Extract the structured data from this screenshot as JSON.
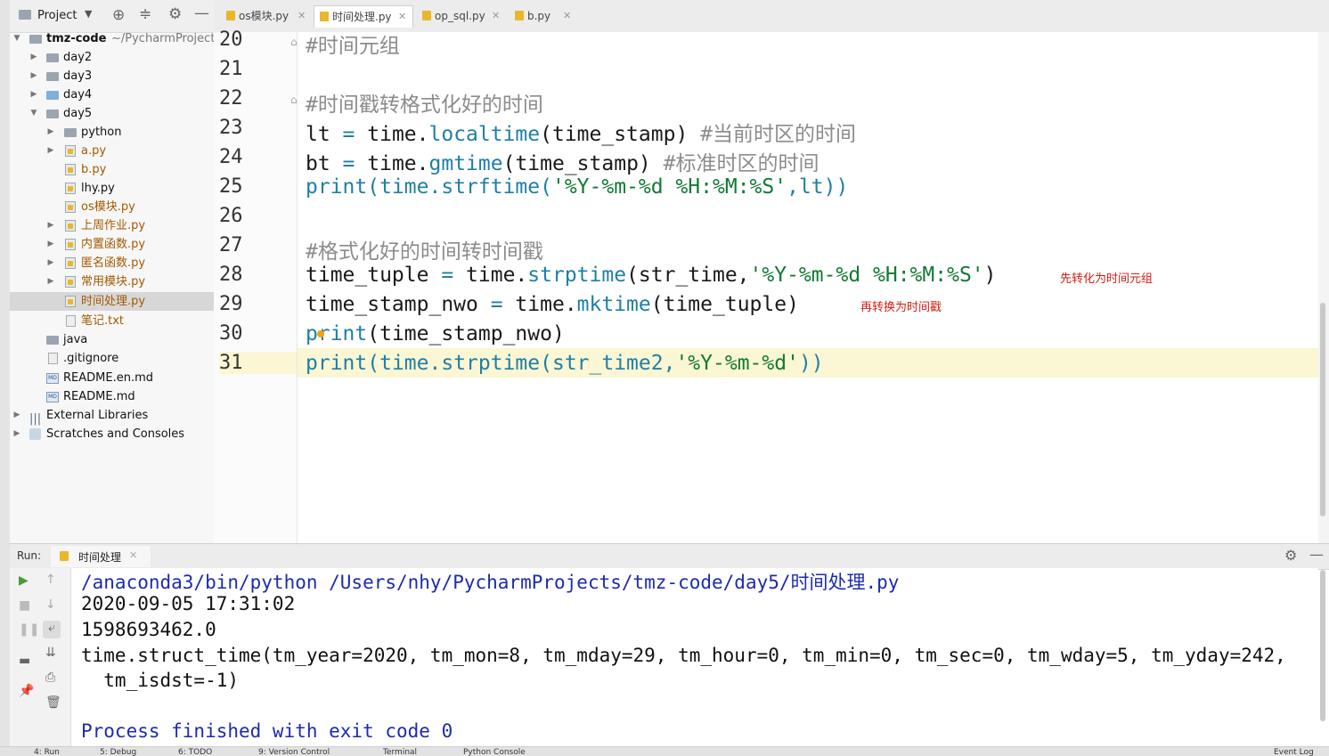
{
  "project_panel": {
    "title": "Project",
    "root": {
      "name": "tmz-code",
      "path": "~/PycharmProject"
    },
    "items": [
      {
        "label": "day2",
        "kind": "folder"
      },
      {
        "label": "day3",
        "kind": "folder"
      },
      {
        "label": "day4",
        "kind": "folder"
      },
      {
        "label": "day5",
        "kind": "folder"
      },
      {
        "label": "python",
        "kind": "folder"
      },
      {
        "label": "a.py",
        "kind": "py"
      },
      {
        "label": "b.py",
        "kind": "py"
      },
      {
        "label": "lhy.py",
        "kind": "py"
      },
      {
        "label": "os模块.py",
        "kind": "py"
      },
      {
        "label": "上周作业.py",
        "kind": "py"
      },
      {
        "label": "内置函数.py",
        "kind": "py"
      },
      {
        "label": "匿名函数.py",
        "kind": "py"
      },
      {
        "label": "常用模块.py",
        "kind": "py"
      },
      {
        "label": "时间处理.py",
        "kind": "py"
      },
      {
        "label": "笔记.txt",
        "kind": "txt"
      },
      {
        "label": "java",
        "kind": "folder"
      },
      {
        "label": ".gitignore",
        "kind": "file"
      },
      {
        "label": "README.en.md",
        "kind": "md"
      },
      {
        "label": "README.md",
        "kind": "md"
      },
      {
        "label": "External Libraries",
        "kind": "lib"
      },
      {
        "label": "Scratches and Consoles",
        "kind": "scratch"
      }
    ]
  },
  "tabs": [
    {
      "label": "os模块.py"
    },
    {
      "label": "时间处理.py",
      "active": true
    },
    {
      "label": "op_sql.py"
    },
    {
      "label": "b.py"
    }
  ],
  "editor": {
    "line_numbers": [
      "20",
      "21",
      "22",
      "23",
      "24",
      "25",
      "26",
      "27",
      "28",
      "29",
      "30",
      "31"
    ],
    "lines": {
      "l20": "#时间元组",
      "l22": "#时间戳转格式化好的时间",
      "l23a": "lt ",
      "l23b": "=",
      "l23c": " time.",
      "l23d": "localtime",
      "l23e": "(time_stamp) ",
      "l23f": "#当前时区的时间",
      "l24a": "bt ",
      "l24b": "=",
      "l24c": " time.",
      "l24d": "gmtime",
      "l24e": "(time_stamp) ",
      "l24f": "#标准时区的时间",
      "l25a": "print",
      "l25b": "(time.",
      "l25c": "strftime",
      "l25d": "(",
      "l25e": "'%Y-%m-%d %H:%M:%S'",
      "l25f": ",lt))",
      "l27": "#格式化好的时间转时间戳",
      "l28a": "time_tuple ",
      "l28b": "=",
      "l28c": " time.",
      "l28d": "strptime",
      "l28e": "(str_time,",
      "l28f": "'%Y-%m-%d %H:%M:%S'",
      "l28g": ")",
      "l29a": "time_stamp_nwo ",
      "l29b": "=",
      "l29c": " time.",
      "l29d": "mktime",
      "l29e": "(time_tuple)",
      "l30a": "print",
      "l30b": "(time_stamp_nwo)",
      "l31a": "print",
      "l31b": "(time.",
      "l31c": "strptime",
      "l31d": "(str_time2,",
      "l31e": "'%Y-%m-%d'",
      "l31f": "))"
    },
    "annotations": {
      "a1": "先转化为时间元组",
      "a2": "再转换为时间戳"
    }
  },
  "run_panel": {
    "label": "Run:",
    "tab": "时间处理",
    "output": [
      "/anaconda3/bin/python /Users/nhy/PycharmProjects/tmz-code/day5/时间处理.py",
      "2020-09-05 17:31:02",
      "1598693462.0",
      "time.struct_time(tm_year=2020, tm_mon=8, tm_mday=29, tm_hour=0, tm_min=0, tm_sec=0, tm_wday=5, tm_yday=242,",
      "  tm_isdst=-1)",
      "",
      "Process finished with exit code 0"
    ]
  },
  "bottom_bar": {
    "items": [
      "4: Run",
      "5: Debug",
      "6: TODO",
      "9: Version Control",
      "Terminal",
      "Python Console",
      "Event Log"
    ]
  },
  "colors": {
    "comment": "#8c8c8c",
    "function": "#1f7fa6",
    "string": "#127a33",
    "annotation": "#d41d14",
    "console_path": "#1d2bb0"
  }
}
